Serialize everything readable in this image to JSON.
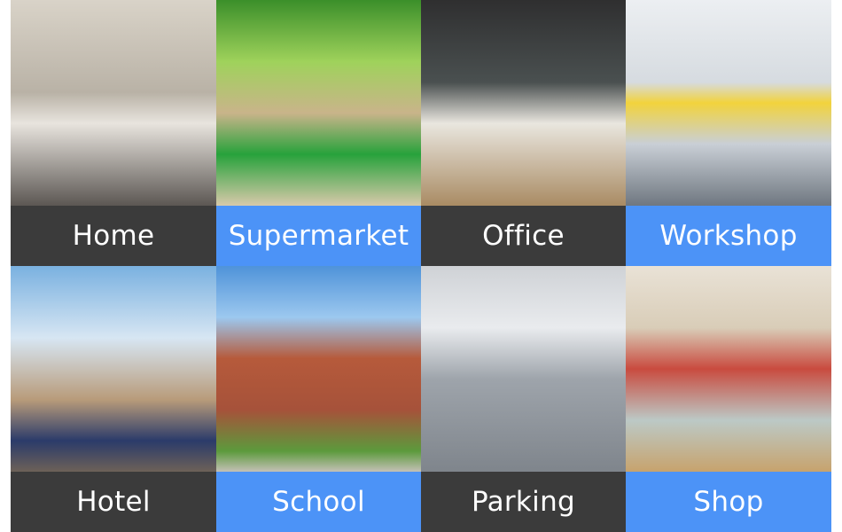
{
  "tiles": [
    {
      "label": "Home",
      "scene": "living room",
      "label_color": "#3b3b3b"
    },
    {
      "label": "Supermarket",
      "scene": "supermarket",
      "label_color": "#4c93f7"
    },
    {
      "label": "Office",
      "scene": "office",
      "label_color": "#3b3b3b"
    },
    {
      "label": "Workshop",
      "scene": "workshop",
      "label_color": "#4c93f7"
    },
    {
      "label": "Hotel",
      "scene": "hotel lobby",
      "label_color": "#3b3b3b"
    },
    {
      "label": "School",
      "scene": "school building",
      "label_color": "#4c93f7"
    },
    {
      "label": "Parking",
      "scene": "parking garage",
      "label_color": "#3b3b3b"
    },
    {
      "label": "Shop",
      "scene": "convenience shop",
      "label_color": "#4c93f7"
    }
  ]
}
